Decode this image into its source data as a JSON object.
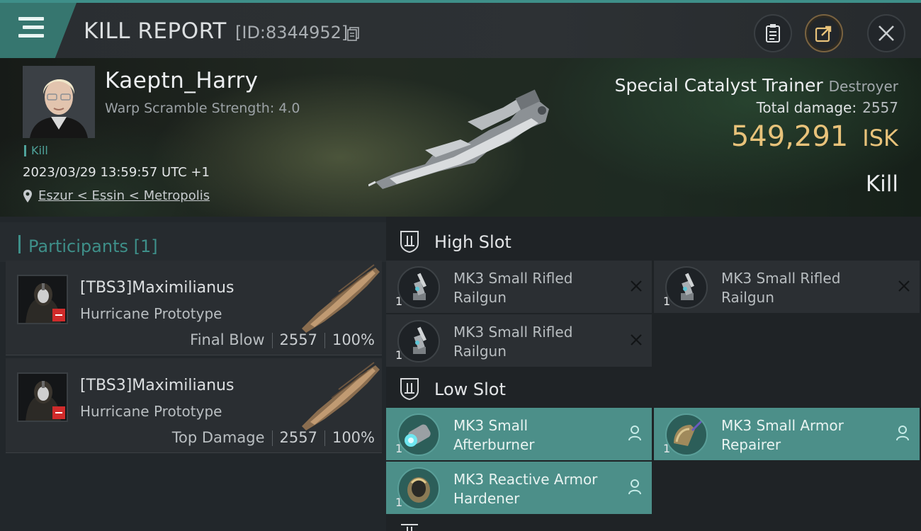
{
  "header": {
    "title": "KILL REPORT",
    "report_id": "[ID:8344952]",
    "menu_icon": "hamburger-menu-icon",
    "buttons": [
      "clipboard-icon",
      "share-icon",
      "close-icon"
    ]
  },
  "victim": {
    "pilot_name": "Kaeptn_Harry",
    "warp_scramble": "Warp Scramble Strength: 4.0",
    "kill_tag": "Kill",
    "timestamp": "2023/03/29 13:59:57 UTC +1",
    "location": "Eszur < Essin < Metropolis",
    "ship_name": "Special Catalyst Trainer",
    "ship_class": "Destroyer",
    "total_damage_label": "Total damage:",
    "total_damage": "2557",
    "isk_value": "549,291",
    "isk_unit": "ISK",
    "result": "Kill"
  },
  "participants": {
    "title": "Participants",
    "count": "[1]",
    "rows": [
      {
        "name": "[TBS3]Maximilianus",
        "ship": "Hurricane Prototype",
        "role": "Final Blow",
        "damage": "2557",
        "percent": "100%"
      },
      {
        "name": "[TBS3]Maximilianus",
        "ship": "Hurricane Prototype",
        "role": "Top Damage",
        "damage": "2557",
        "percent": "100%"
      }
    ]
  },
  "fitting": {
    "high_slot": {
      "title": "High Slot",
      "modules": [
        {
          "name": "MK3 Small Rifled Railgun",
          "qty": "1",
          "state": "destroyed"
        },
        {
          "name": "MK3 Small Rifled Railgun",
          "qty": "1",
          "state": "destroyed"
        },
        {
          "name": "MK3 Small Rifled Railgun",
          "qty": "1",
          "state": "destroyed"
        }
      ]
    },
    "low_slot": {
      "title": "Low Slot",
      "modules": [
        {
          "name": "MK3 Small Afterburner",
          "qty": "1",
          "state": "dropped"
        },
        {
          "name": "MK3 Small Armor Repairer",
          "qty": "1",
          "state": "dropped"
        },
        {
          "name": "MK3 Reactive Armor Hardener",
          "qty": "1",
          "state": "dropped"
        }
      ]
    }
  },
  "colors": {
    "accent_teal": "#3e8f89",
    "dropped_slot": "#4c8f89",
    "isk_gold": "#e8c27a",
    "loss_badge": "#d02b2b"
  }
}
